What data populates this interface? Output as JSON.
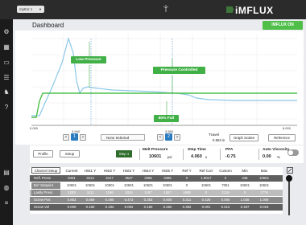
{
  "topbar": {
    "machine": "mytmr 1",
    "brand": "iMFLUX"
  },
  "header": {
    "title": "Dashboard",
    "influx_button": "IMFLUX ON"
  },
  "sidebar": {
    "icons": [
      "gear-icon",
      "grid-icon",
      "monitor-icon",
      "list-icon",
      "bell-icon",
      "help-icon",
      "film-icon",
      "globe-icon",
      "sliders-icon"
    ]
  },
  "chart": {
    "x_tick_start": "0.000",
    "x_tick_end": "8.000",
    "callouts": {
      "low_pressure": "Low Pressure",
      "pressure_controlled": "Pressure Controlled",
      "full": "80% Full"
    },
    "colors": {
      "pressure": "#8cc8e8",
      "line": "#4cc04c",
      "callout": "#41b047"
    }
  },
  "chart_controls": {
    "cursor_a": {
      "value": "3.940",
      "index": "1"
    },
    "cursor_b": {
      "value": "3.560",
      "index": "2"
    },
    "none_selected": "None Selected",
    "travel_label": "Travel",
    "travel_value": "0.863 in",
    "graph_scales": "Graph Scales",
    "reference": "Reference",
    "prev": "<",
    "next": ">"
  },
  "metrics": {
    "profile": "Profile",
    "setup": "Setup",
    "step": "Step 1",
    "melt_pressure": {
      "label": "Melt Pressure",
      "value": "10601",
      "unit": "psi"
    },
    "step_time": {
      "label": "Step Time",
      "value": "4.060",
      "unit": "s"
    },
    "pfa": {
      "label": "PFA",
      "value": "-0.75"
    },
    "auto_viscosity": {
      "label": "Auto Viscosity",
      "value": "0.00",
      "unit": "%"
    }
  },
  "table": {
    "channel_setup": "Channel Setup",
    "columns": [
      "Current",
      "Hist1 Y",
      "Hist2 Y",
      "Hist3 Y",
      "Hist4 Y",
      "Hist5 Y",
      "Ref Y",
      "Ref Corr",
      "Custom",
      "Min",
      "Max"
    ],
    "rows": [
      {
        "name": "Refl. Press",
        "style": "dark",
        "values": [
          "8401",
          "3313",
          "3417",
          "3547",
          "3395",
          "3395",
          "0",
          "1.9017",
          "0",
          "436",
          "10601"
        ]
      },
      {
        "name": "Bo* Setpoint",
        "style": "white",
        "values": [
          "10601",
          "10601",
          "10601",
          "10601",
          "10601",
          "10601",
          "0",
          "10601",
          "7061",
          "10601",
          "10601"
        ]
      },
      {
        "name": "Lastly Press",
        "style": "light",
        "values": [
          "1283",
          "1111",
          "1196",
          "1024",
          "1197",
          "1267",
          "1608",
          "0",
          "2119",
          "0",
          "2779"
        ]
      },
      {
        "name": "Screw Pos",
        "style": "mid",
        "values": [
          "0.853",
          "0.859",
          "0.480",
          "0.473",
          "0.383",
          "0.600",
          "0.311",
          "0.426",
          "0.000",
          "1.038",
          "1.009"
        ]
      },
      {
        "name": "Screw Vel",
        "style": "dark",
        "values": [
          "0.000",
          "0.180",
          "0.182",
          "0.002",
          "0.180",
          "0.282",
          "0.382",
          "0.001",
          "0.612",
          "0.487",
          "0.019"
        ]
      }
    ]
  }
}
